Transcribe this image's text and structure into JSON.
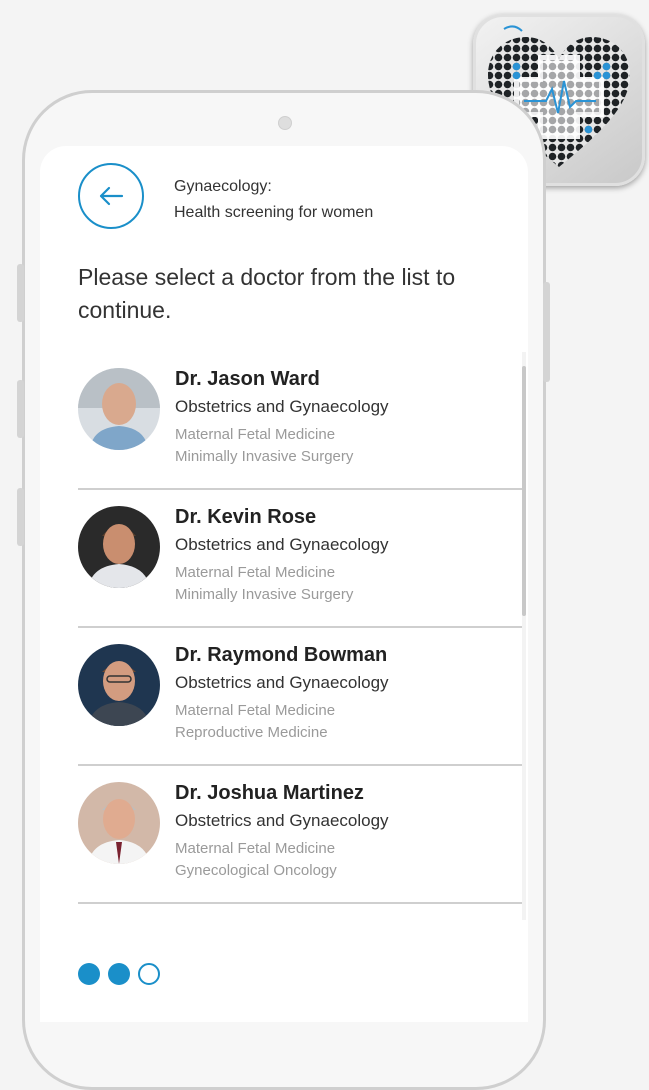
{
  "header": {
    "category": "Gynaecology:",
    "subtitle": "Health screening for women"
  },
  "prompt": "Please select a doctor from the list to continue.",
  "doctors": [
    {
      "name": "Dr. Jason Ward",
      "specialty": "Obstetrics and Gynaecology",
      "sub1": "Maternal Fetal Medicine",
      "sub2": "Minimally Invasive Surgery"
    },
    {
      "name": "Dr. Kevin Rose",
      "specialty": "Obstetrics and Gynaecology",
      "sub1": "Maternal Fetal Medicine",
      "sub2": "Minimally Invasive Surgery"
    },
    {
      "name": "Dr. Raymond Bowman",
      "specialty": "Obstetrics and Gynaecology",
      "sub1": "Maternal Fetal Medicine",
      "sub2": "Reproductive Medicine"
    },
    {
      "name": "Dr. Joshua Martinez",
      "specialty": "Obstetrics and Gynaecology",
      "sub1": "Maternal Fetal Medicine",
      "sub2": "Gynecological Oncology"
    }
  ],
  "pagination": {
    "current_step": 2,
    "total_steps": 3
  },
  "colors": {
    "accent": "#1a8fc9",
    "logo_dark": "#1f2326",
    "logo_blue": "#2a93d5"
  },
  "icons": {
    "back": "arrow-left-icon",
    "logo": "heart-pulse-logo-icon"
  }
}
